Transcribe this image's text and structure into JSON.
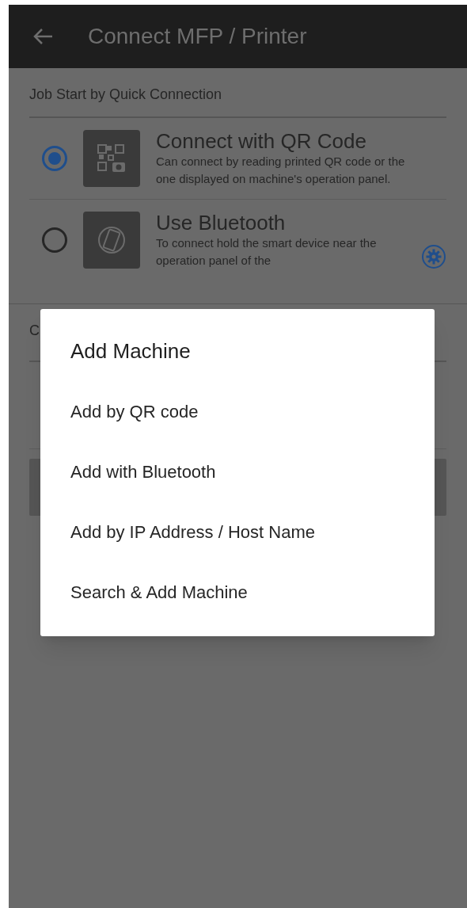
{
  "app_bar": {
    "title": "Connect MFP / Printer"
  },
  "quick_connection": {
    "heading": "Job Start by Quick Connection",
    "options": [
      {
        "kind": "qr",
        "title": "Connect with QR Code",
        "description": "Can connect by reading printed QR code or the one displayed on machine's operation panel.",
        "selected": true,
        "settings": false
      },
      {
        "kind": "bluetooth",
        "title": "Use Bluetooth",
        "description": "To connect hold the smart device near the operation panel of the",
        "selected": false,
        "settings": true
      }
    ]
  },
  "section_2": {
    "heading": "C"
  },
  "dialog": {
    "title": "Add Machine",
    "items": [
      "Add by QR code",
      "Add with Bluetooth",
      "Add by IP Address / Host Name",
      "Search & Add Machine"
    ]
  }
}
